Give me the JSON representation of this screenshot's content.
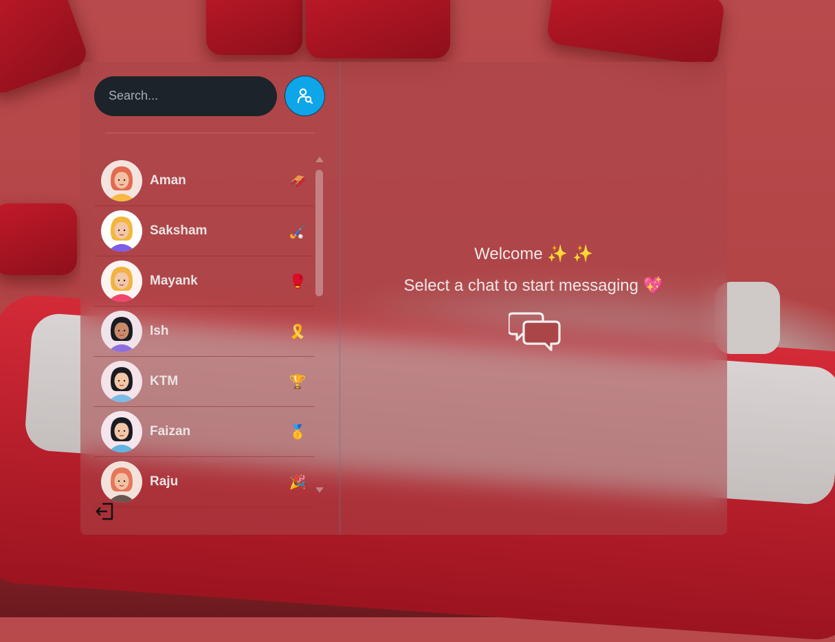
{
  "search": {
    "placeholder": "Search..."
  },
  "conversations": [
    {
      "name": "Aman",
      "emoji": "🛷",
      "avatar": {
        "skin": "#f2c1a3",
        "hair": "#e3694f",
        "shirt": "#f5b944",
        "bg": "#f3e4df"
      }
    },
    {
      "name": "Saksham",
      "emoji": "🏑",
      "avatar": {
        "skin": "#f2c7a8",
        "hair": "#f3b63c",
        "shirt": "#7d5ce8",
        "bg": "#ffffff"
      }
    },
    {
      "name": "Mayank",
      "emoji": "🥊",
      "avatar": {
        "skin": "#f2c7a8",
        "hair": "#f2b23f",
        "shirt": "#f0466c",
        "bg": "#fdf4f2"
      }
    },
    {
      "name": "Ish",
      "emoji": "🎗️",
      "avatar": {
        "skin": "#c98a6b",
        "hair": "#1b1b22",
        "shirt": "#8d6fdc",
        "bg": "#f0e3ea"
      }
    },
    {
      "name": "KTM",
      "emoji": "🏆",
      "avatar": {
        "skin": "#f2c7a8",
        "hair": "#1b1b22",
        "shirt": "#7bbbe8",
        "bg": "#f4e3e8"
      }
    },
    {
      "name": "Faizan",
      "emoji": "🥇",
      "avatar": {
        "skin": "#f2c7a8",
        "hair": "#1b1b22",
        "shirt": "#62b4e0",
        "bg": "#f4e6ec"
      }
    },
    {
      "name": "Raju",
      "emoji": "🎉",
      "avatar": {
        "skin": "#f2c1a3",
        "hair": "#e6765a",
        "shirt": "#6b5550",
        "bg": "#f3e2dc"
      }
    }
  ],
  "welcome": {
    "line1": "Welcome ✨ ✨",
    "line2": "Select a chat to start messaging 💖"
  },
  "colors": {
    "accent": "#0ea5e9",
    "search_bg": "#1d232a"
  },
  "icons": {
    "search_button": "search-user-icon",
    "logout": "logout-icon",
    "chat": "chat-bubbles-icon"
  }
}
